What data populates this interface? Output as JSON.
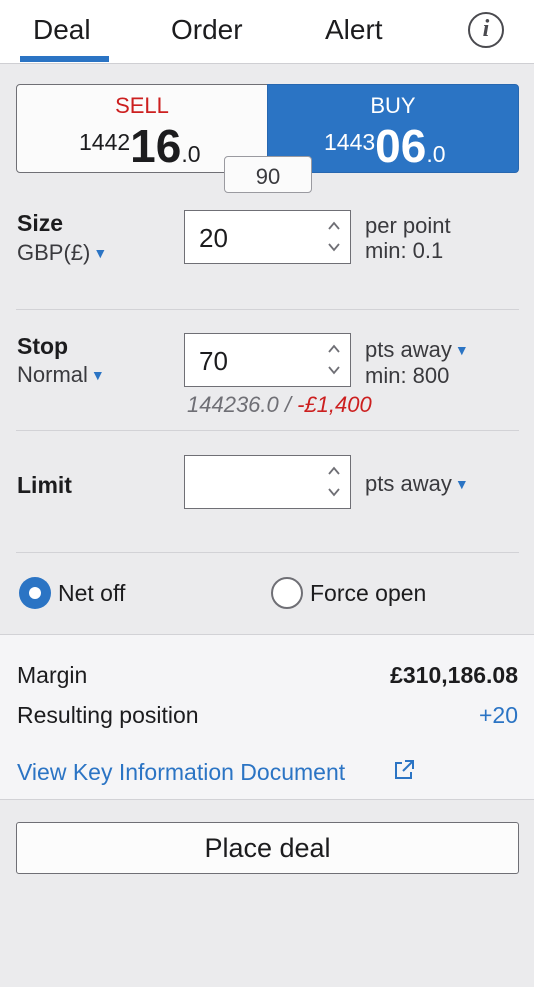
{
  "tabs": [
    {
      "label": "Deal",
      "active": true
    },
    {
      "label": "Order",
      "active": false
    },
    {
      "label": "Alert",
      "active": false
    }
  ],
  "info_icon": "info-icon",
  "sell": {
    "label": "SELL",
    "price_small": "1442",
    "price_big": "16",
    "price_decimal": ".0"
  },
  "buy": {
    "label": "BUY",
    "price_small": "1443",
    "price_big": "06",
    "price_decimal": ".0"
  },
  "spread": "90",
  "size": {
    "label": "Size",
    "currency": "GBP(£)",
    "value": "20",
    "unit": "per point",
    "min": "min: 0.1"
  },
  "stop": {
    "label": "Stop",
    "type": "Normal",
    "value": "70",
    "unit": "pts away",
    "min": "min: 800",
    "calc_level": "144236.0 /",
    "calc_amount": "-£1,400"
  },
  "limit": {
    "label": "Limit",
    "value": "",
    "unit": "pts away"
  },
  "position_mode": {
    "options": [
      "Net off",
      "Force open"
    ],
    "selected": "Net off"
  },
  "summary": {
    "margin_label": "Margin",
    "margin_value": "£310,186.08",
    "resulting_label": "Resulting position",
    "resulting_value": "+20"
  },
  "kid_link": "View Key Information Document",
  "place_deal": "Place deal",
  "colors": {
    "accent": "#2b74c4",
    "sell_red": "#cc1f1f",
    "background": "#ebebed"
  }
}
